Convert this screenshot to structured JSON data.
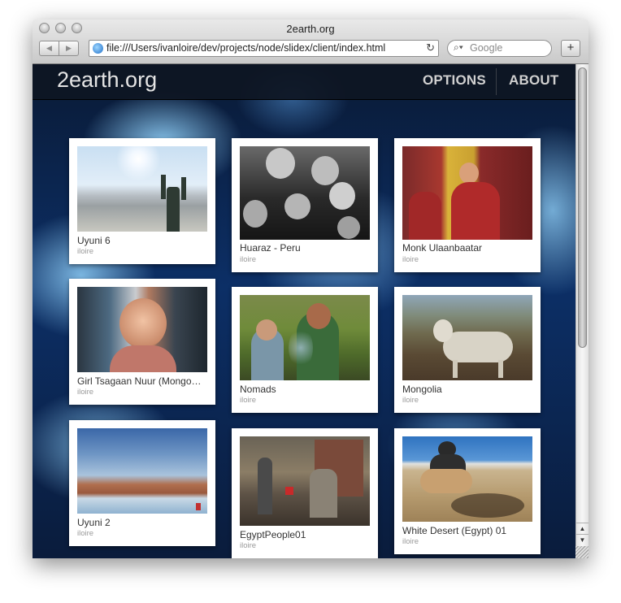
{
  "window": {
    "title": "2earth.org",
    "url": "file:///Users/ivanloire/dev/projects/node/slidex/client/index.html",
    "search_placeholder": "Google",
    "back_glyph": "◀",
    "forward_glyph": "▶",
    "reload_glyph": "↻",
    "plus_glyph": "+",
    "search_glyph": "⌕▾"
  },
  "site": {
    "logo": "2earth.org",
    "nav": [
      "OPTIONS",
      "ABOUT"
    ]
  },
  "photos": [
    {
      "title": "Uyuni 6",
      "owner": "iloire"
    },
    {
      "title": "Huaraz - Peru",
      "owner": "iloire"
    },
    {
      "title": "Monk Ulaanbaatar",
      "owner": "iloire"
    },
    {
      "title": "Girl Tsagaan Nuur (Mongo…",
      "owner": "iloire"
    },
    {
      "title": "Nomads",
      "owner": "iloire"
    },
    {
      "title": "Mongolia",
      "owner": "iloire"
    },
    {
      "title": "Uyuni 2",
      "owner": "iloire"
    },
    {
      "title": "EgyptPeople01",
      "owner": "iloire"
    },
    {
      "title": "White Desert (Egypt) 01",
      "owner": "iloire"
    }
  ],
  "scrollbar": {
    "up_glyph": "▲",
    "down_glyph": "▼"
  }
}
